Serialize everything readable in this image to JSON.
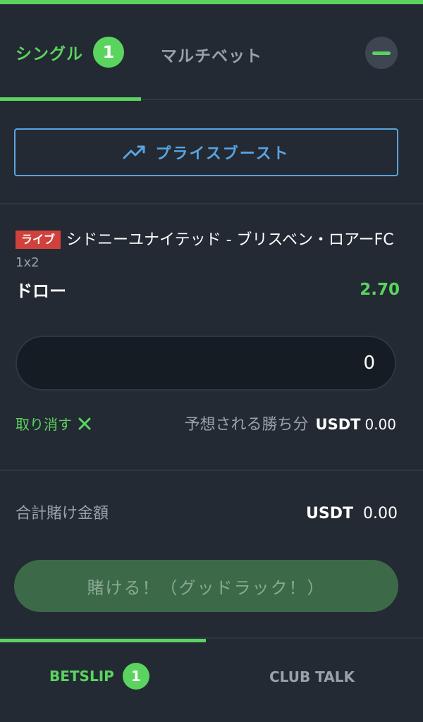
{
  "tabs": {
    "single_label": "シングル",
    "single_count": "1",
    "multi_label": "マルチベット"
  },
  "boost": {
    "label": "プライスブースト",
    "icon": "trending-up-icon"
  },
  "selection": {
    "live_label": "ライブ",
    "event_name": "シドニーユナイテッド - ブリスベン・ロアーFC",
    "market": "1x2",
    "pick": "ドロー",
    "odds": "2.70",
    "stake_value": "0"
  },
  "actions": {
    "cancel_label": "取り消す",
    "expected_win_label": "予想される勝ち分",
    "expected_win_currency": "USDT",
    "expected_win_amount": "0.00"
  },
  "totals": {
    "label": "合計賭け金額",
    "currency": "USDT",
    "amount": "0.00"
  },
  "bet_button_label": "賭ける！（グッドラック！）",
  "bottom_nav": {
    "betslip_label": "BETSLIP",
    "betslip_count": "1",
    "club_talk_label": "CLUB TALK"
  },
  "colors": {
    "accent_green": "#5bd45f",
    "boost_blue": "#5aa3e0",
    "live_red": "#d0413b",
    "background": "#232a33"
  }
}
